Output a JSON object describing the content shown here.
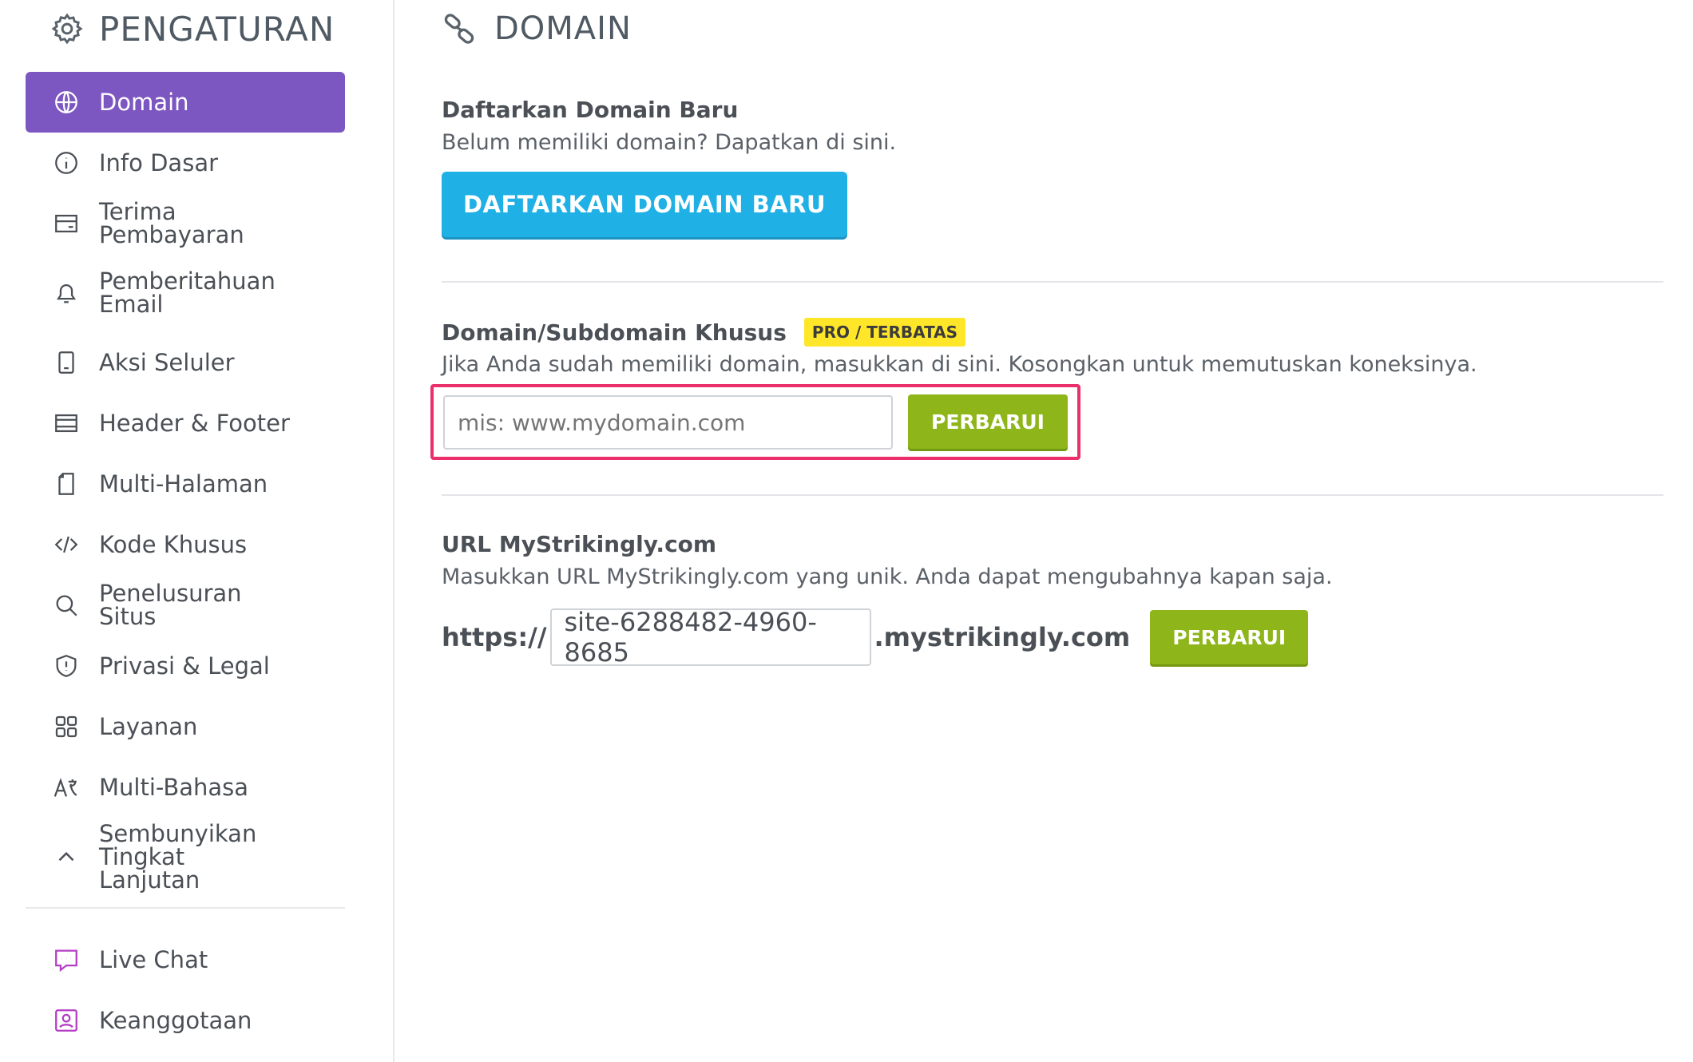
{
  "sidebar": {
    "title": "PENGATURAN",
    "items": [
      {
        "label": "Domain",
        "icon": "globe-icon",
        "active": true
      },
      {
        "label": "Info Dasar",
        "icon": "info-icon"
      },
      {
        "label": "Terima Pembayaran",
        "icon": "payment-card-icon"
      },
      {
        "label": "Pemberitahuan Email",
        "icon": "bell-icon"
      },
      {
        "label": "Aksi Seluler",
        "icon": "mobile-icon"
      },
      {
        "label": "Header & Footer",
        "icon": "header-footer-icon"
      },
      {
        "label": "Multi-Halaman",
        "icon": "page-icon"
      },
      {
        "label": "Kode Khusus",
        "icon": "code-icon"
      },
      {
        "label": "Penelusuran Situs",
        "icon": "search-icon"
      },
      {
        "label": "Privasi & Legal",
        "icon": "shield-icon"
      },
      {
        "label": "Layanan",
        "icon": "grid-icon"
      },
      {
        "label": "Multi-Bahasa",
        "icon": "translate-icon"
      },
      {
        "label": "Sembunyikan Tingkat Lanjutan",
        "icon": "chevron-up-icon"
      }
    ],
    "extra_items": [
      {
        "label": "Live Chat",
        "icon": "chat-icon"
      },
      {
        "label": "Keanggotaan",
        "icon": "membership-icon"
      }
    ]
  },
  "main": {
    "title": "DOMAIN",
    "register": {
      "title": "Daftarkan Domain Baru",
      "desc": "Belum memiliki domain? Dapatkan di sini.",
      "button": "DAFTARKAN DOMAIN BARU"
    },
    "custom": {
      "title": "Domain/Subdomain Khusus",
      "badge": "PRO / TERBATAS",
      "desc": "Jika Anda sudah memiliki domain, masukkan di sini. Kosongkan untuk memutuskan koneksinya.",
      "placeholder": "mis: www.mydomain.com",
      "button": "PERBARUI"
    },
    "url": {
      "title": "URL MyStrikingly.com",
      "desc": "Masukkan URL MyStrikingly.com yang unik. Anda dapat mengubahnya kapan saja.",
      "prefix": "https://",
      "value": "site-6288482-4960-8685",
      "suffix": ".mystrikingly.com",
      "button": "PERBARUI"
    }
  },
  "colors": {
    "active_nav": "#7d57c1",
    "primary_button": "#1fb0e6",
    "update_button": "#8eb61b",
    "badge": "#ffe629",
    "highlight": "#ea2f6b",
    "extra_icons": "#b43ec4"
  }
}
